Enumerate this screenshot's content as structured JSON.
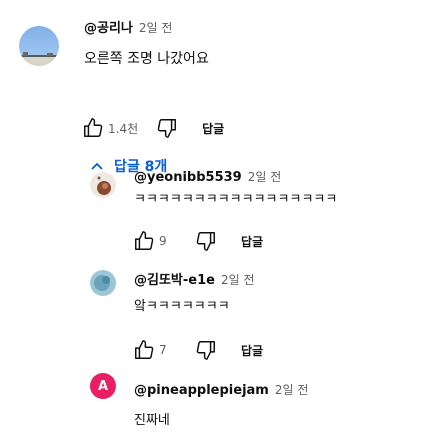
{
  "comments": [
    {
      "handle": "@공리나",
      "time": "2일 전",
      "text": "오른쪽 조명 나갔어요",
      "likes": "1.4천",
      "reply_label": "답글",
      "avatar_icon": "sky-landscape-avatar"
    }
  ],
  "replies_toggle": {
    "label": "답글 8개",
    "icon": "chevron-up-icon",
    "color": "#065fd4"
  },
  "replies": [
    {
      "handle": "@yeonibb5539",
      "time": "2일 전",
      "text": "ㅋㅋㅋㅋㅋㅋㅋㅋㅋㅋㅋㅋㅋㅋㅋㅋㅋ",
      "likes": "9",
      "reply_label": "답글"
    },
    {
      "handle": "@김또박-e1e",
      "time": "2일 전",
      "text": "앜ㅋㅋㅋㅋㅋㅋㅋ",
      "likes": "7",
      "reply_label": "답글"
    },
    {
      "handle": "@pineapplepiejam",
      "time": "2일 전",
      "text": "진짜네",
      "avatar_letter": "A",
      "avatar_color": "#e91e63"
    }
  ]
}
